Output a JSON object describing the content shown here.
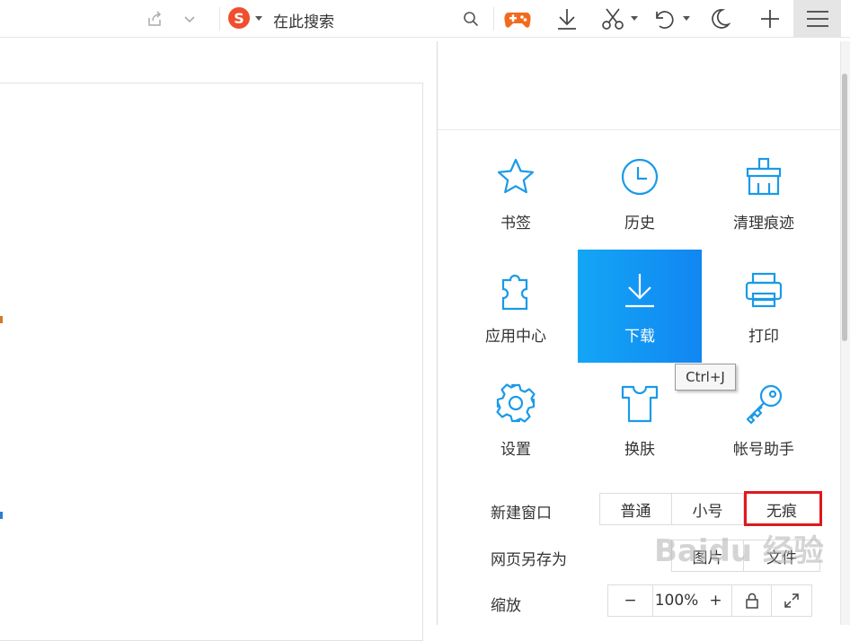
{
  "toolbar": {
    "search_engine": "S",
    "search_placeholder": "在此搜索",
    "icons": [
      "share-icon",
      "chevron-down-icon",
      "sogou-logo",
      "search-icon",
      "game-controller-icon",
      "download-icon",
      "scissors-icon",
      "undo-icon",
      "night-mode-icon",
      "plus-icon",
      "hamburger-menu-icon"
    ]
  },
  "menu": {
    "tiles": [
      {
        "label": "书签",
        "icon": "star-icon"
      },
      {
        "label": "历史",
        "icon": "clock-icon"
      },
      {
        "label": "清理痕迹",
        "icon": "broom-icon"
      },
      {
        "label": "应用中心",
        "icon": "puzzle-icon"
      },
      {
        "label": "下载",
        "icon": "download-icon"
      },
      {
        "label": "打印",
        "icon": "printer-icon"
      },
      {
        "label": "设置",
        "icon": "gear-icon"
      },
      {
        "label": "换肤",
        "icon": "tshirt-icon"
      },
      {
        "label": "帐号助手",
        "icon": "key-icon"
      }
    ],
    "tooltip": "Ctrl+J",
    "new_window": {
      "label": "新建窗口",
      "options": [
        "普通",
        "小号",
        "无痕"
      ]
    },
    "save_as": {
      "label": "网页另存为",
      "options": [
        "图片",
        "文件"
      ]
    },
    "zoom": {
      "label": "缩放",
      "minus": "−",
      "value": "100%",
      "plus": "+"
    }
  },
  "watermark": "Baidu 经验",
  "colors": {
    "accent_blue": "#1296f3",
    "icon_blue": "#1a9ae8",
    "highlight_red": "#e0181b",
    "sogou_red": "#f04e2e"
  }
}
